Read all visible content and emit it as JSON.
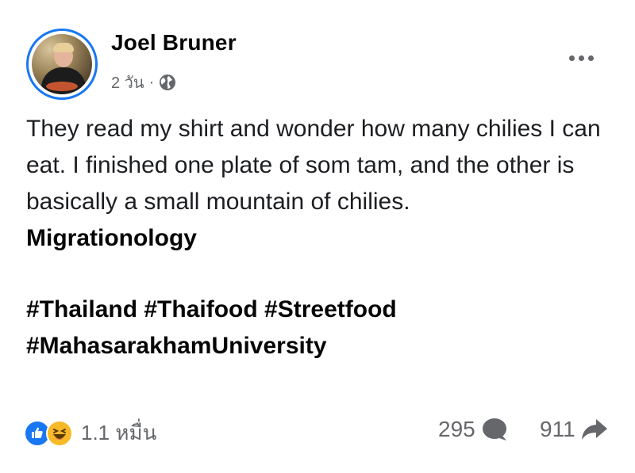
{
  "post": {
    "author": "Joel Bruner",
    "time": "2 วัน",
    "separator": "·",
    "privacy_icon": "globe-icon",
    "text": "They read my shirt and wonder how many chilies I can eat. I finished one plate of som tam, and the other is basically a small mountain of chilies.",
    "tag_link": "Migrationology",
    "hashtags": [
      "#Thailand",
      "#Thaifood",
      "#Streetfood",
      "#MahasarakhamUniversity"
    ],
    "more_icon": "more-options-icon"
  },
  "footer": {
    "reaction_icons": [
      "like-icon",
      "haha-icon"
    ],
    "reaction_count": "1.1 หมื่น",
    "comment_count": "295",
    "comment_icon": "comment-icon",
    "share_count": "911",
    "share_icon": "share-icon"
  },
  "colors": {
    "accent": "#1877f2",
    "secondary_text": "#65676b",
    "haha": "#f7b928"
  }
}
